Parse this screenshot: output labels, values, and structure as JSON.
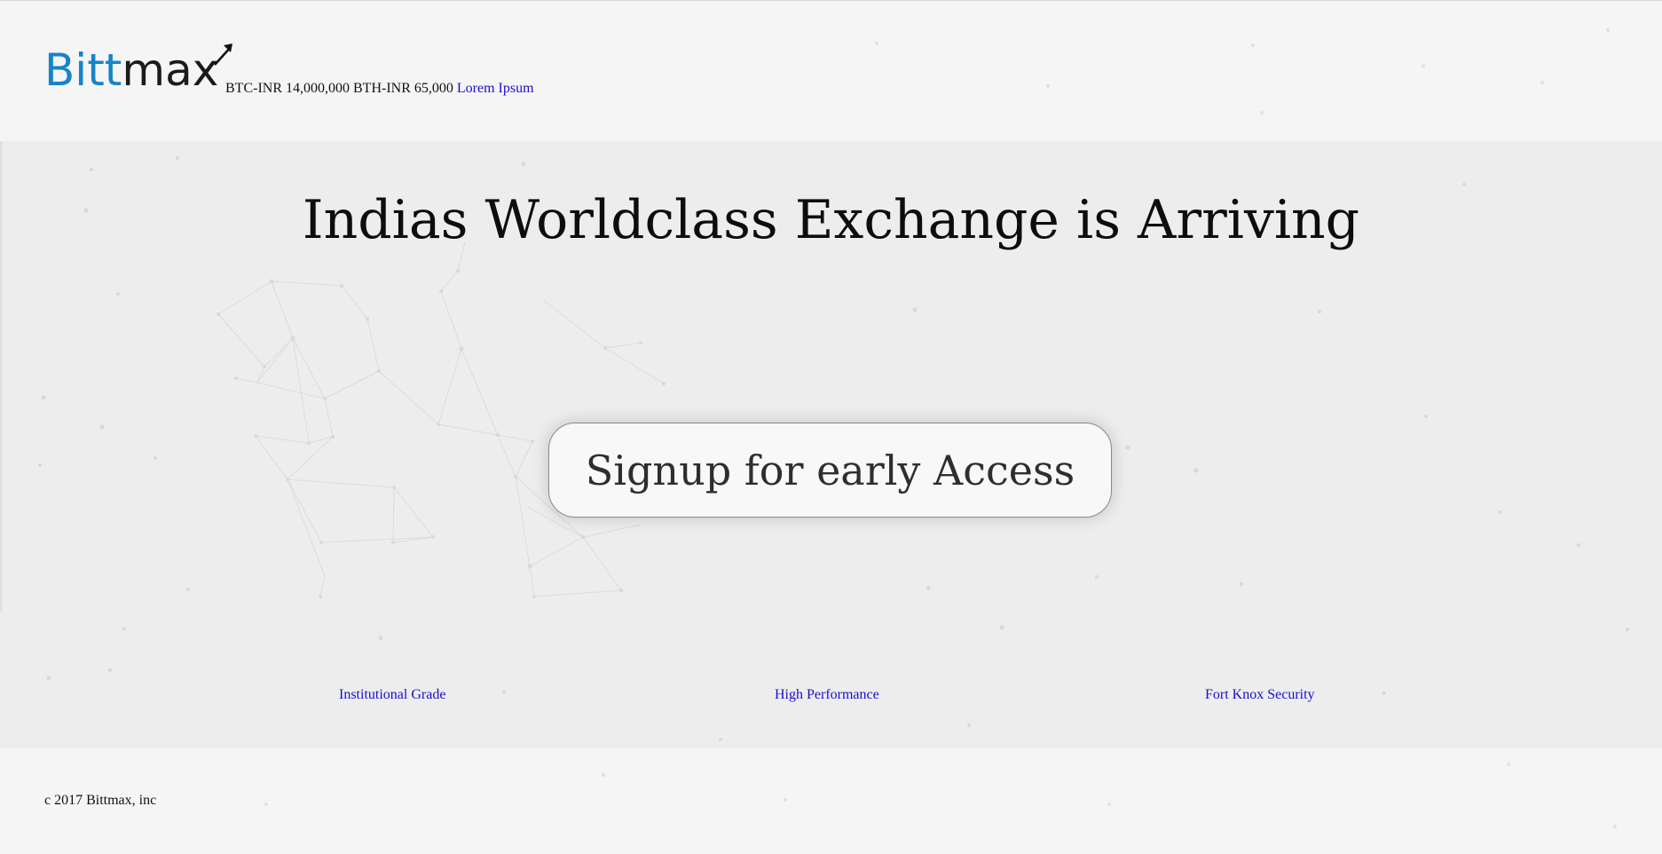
{
  "header": {
    "logo_text_blue": "Bitt",
    "logo_text_dark": "max",
    "ticker_text": "BTC-INR 14,000,000 BTH-INR 65,000",
    "ticker_link": "Lorem Ipsum"
  },
  "hero": {
    "title": "Indias Worldclass Exchange is Arriving",
    "signup_label": "Signup for early Access",
    "features": [
      "Institutional Grade",
      "High Performance",
      "Fort Knox Security"
    ]
  },
  "footer": {
    "copyright": "c 2017 Bittmax, inc"
  },
  "colors": {
    "brand_blue": "#1784c7",
    "link_blue": "#1a0dce",
    "background": "#f4f4f4"
  }
}
